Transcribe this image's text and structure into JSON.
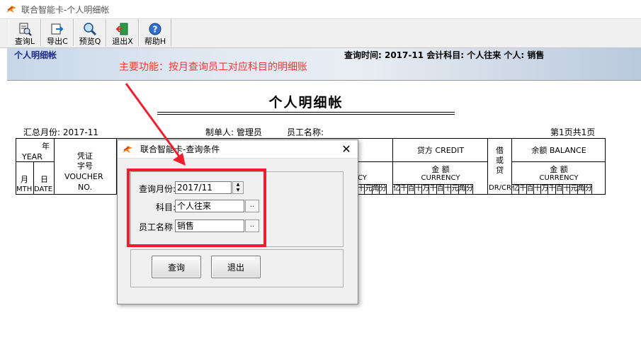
{
  "window": {
    "title": "联合智能卡-个人明细帐"
  },
  "toolbar": {
    "buttons": [
      {
        "label": "查询L",
        "icon": "query-doc-icon"
      },
      {
        "label": "导出C",
        "icon": "export-icon"
      },
      {
        "label": "预览Q",
        "icon": "magnifier-icon"
      },
      {
        "label": "退出X",
        "icon": "exit-door-icon"
      },
      {
        "label": "帮助H",
        "icon": "help-icon"
      }
    ]
  },
  "banner": {
    "page_title": "个人明细帐",
    "info": "查询时间: 2017-11  会计科目: 个人往来  个人: 销售"
  },
  "annotation": "主要功能：按月查询员工对应科目的明细账",
  "report": {
    "title": "个人明细帐",
    "summary_month": "汇总月份: 2017-11",
    "maker": "制单人: 管理员",
    "employee_name": "员工名称:",
    "page_info": "第1页共1页",
    "headers": {
      "year": "年",
      "year_en": "YEAR",
      "month": "月",
      "month_en": "MTH",
      "day": "日",
      "day_en": "DATE",
      "voucher_l1": "凭证",
      "voucher_l2": "字号",
      "voucher_en1": "VOUCHER",
      "voucher_en2": "NO.",
      "debit_currency_partial": "CY",
      "credit": "贷方 CREDIT",
      "amount": "金  额",
      "currency": "CURRENCY",
      "dc_1": "借",
      "dc_2": "或",
      "dc_3": "贷",
      "dc_en": "DR/CR",
      "balance": "余额 BALANCE",
      "digits_partial": [
        "十",
        "元",
        "角",
        "分"
      ],
      "digits_full": [
        "亿",
        "千",
        "百",
        "十",
        "万",
        "千",
        "百",
        "十",
        "元",
        "角",
        "分"
      ]
    }
  },
  "dialog": {
    "title": "联合智能卡-查询条件",
    "close_glyph": "✕",
    "month_label": "查询月份:",
    "month_value": "2017/11",
    "subject_label": "科目:",
    "subject_value": "个人往来",
    "employee_label": "员工名称",
    "employee_value": "销售",
    "browse_label": "..",
    "query_button": "查询",
    "exit_button": "退出"
  },
  "colors": {
    "annotation": "#ff3333",
    "highlight_box": "#f01e2c",
    "banner_title": "#1a2a8a"
  }
}
